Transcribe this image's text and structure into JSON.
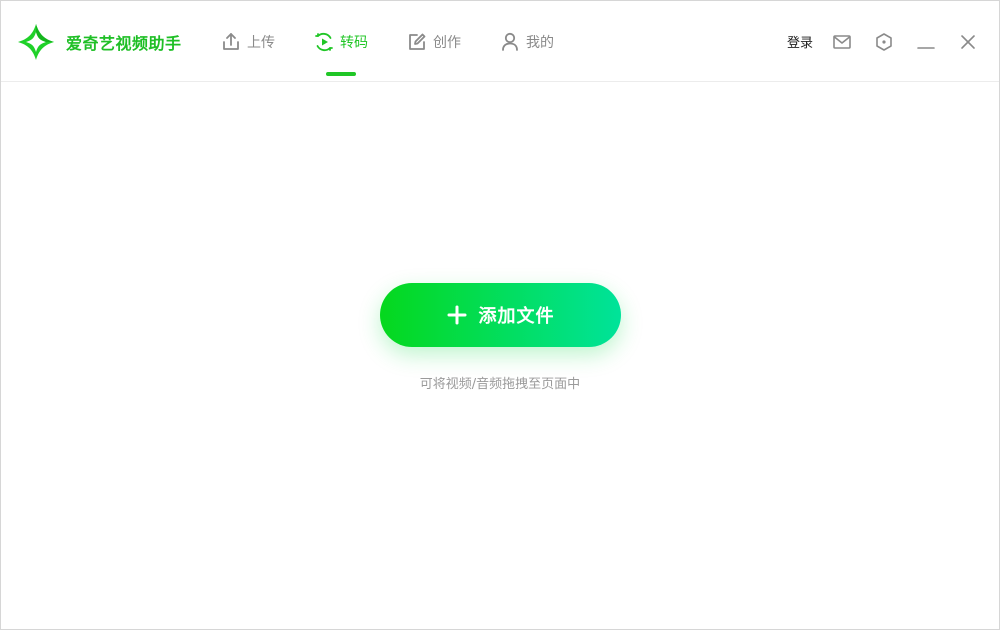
{
  "app": {
    "name": "爱奇艺视频助手",
    "brand_color": "#1fbf26",
    "logo_icon": "iqiyi-star-logo"
  },
  "nav": {
    "tabs": [
      {
        "id": "upload",
        "label": "上传",
        "icon": "upload-icon",
        "active": false
      },
      {
        "id": "transcode",
        "label": "转码",
        "icon": "transcode-icon",
        "active": true
      },
      {
        "id": "create",
        "label": "创作",
        "icon": "edit-icon",
        "active": false
      },
      {
        "id": "mine",
        "label": "我的",
        "icon": "user-icon",
        "active": false
      }
    ],
    "active_color": "#20c626",
    "inactive_color": "#8a8a8a"
  },
  "header_right": {
    "login_label": "登录",
    "icons": [
      "mail-icon",
      "settings-hexagon-icon",
      "minimize-icon",
      "close-icon"
    ]
  },
  "main": {
    "add_button_label": "添加文件",
    "add_button_icon": "plus-icon",
    "hint": "可将视频/音频拖拽至页面中",
    "gradient": [
      "#05d81d",
      "#00e39a"
    ]
  }
}
